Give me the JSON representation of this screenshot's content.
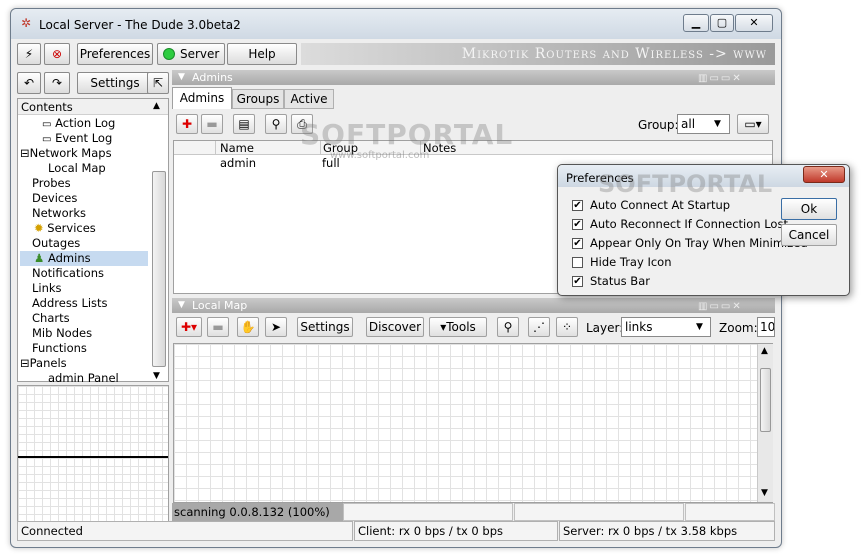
{
  "window": {
    "title": "Local Server - The Dude 3.0beta2",
    "banner": "Mikrotik Routers and Wireless -> www"
  },
  "toolbar": {
    "preferences": "Preferences",
    "server": "Server",
    "help": "Help",
    "settings": "Settings"
  },
  "tree": {
    "header": "Contents",
    "items": [
      "Action Log",
      "Event Log",
      "Network Maps",
      "Local Map",
      "Probes",
      "Devices",
      "Networks",
      "Services",
      "Outages",
      "Admins",
      "Notifications",
      "Links",
      "Address Lists",
      "Charts",
      "Mib Nodes",
      "Functions",
      "Panels",
      "admin Panel"
    ]
  },
  "admins_panel": {
    "title": "Admins",
    "tabs": [
      "Admins",
      "Groups",
      "Active"
    ],
    "group_label": "Group:",
    "group_value": "all",
    "columns": [
      "Name",
      "Group",
      "Notes"
    ],
    "rows": [
      {
        "name": "admin",
        "group": "full",
        "notes": ""
      }
    ]
  },
  "map_panel": {
    "title": "Local Map",
    "settings": "Settings",
    "discover": "Discover",
    "tools": "Tools",
    "layer_label": "Layer:",
    "layer_value": "links",
    "zoom_label": "Zoom:",
    "zoom_value": "10",
    "scanning": "scanning 0.0.8.132 (100%)"
  },
  "status": {
    "connected": "Connected",
    "client": "Client: rx 0 bps / tx 0 bps",
    "server": "Server: rx 0 bps / tx 3.58 kbps"
  },
  "prefs_dialog": {
    "title": "Preferences",
    "ok": "Ok",
    "cancel": "Cancel",
    "options": [
      {
        "label": "Auto Connect At Startup",
        "checked": true
      },
      {
        "label": "Auto Reconnect If Connection Lost",
        "checked": true
      },
      {
        "label": "Appear Only On Tray When Minimized",
        "checked": true
      },
      {
        "label": "Hide Tray Icon",
        "checked": false
      },
      {
        "label": "Status Bar",
        "checked": true
      }
    ]
  },
  "watermark": {
    "text": "SOFTPORTAL",
    "url": "www.softportal.com"
  }
}
